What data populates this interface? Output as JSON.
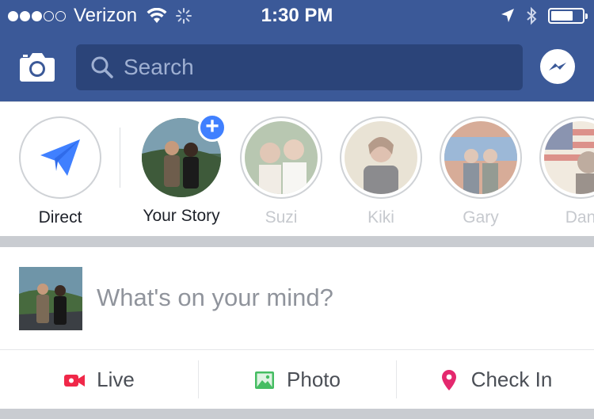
{
  "status_bar": {
    "carrier": "Verizon",
    "time": "1:30 PM",
    "signal_bars_full": 3,
    "signal_bars_total": 5,
    "battery_level": 0.7
  },
  "nav": {
    "search_placeholder": "Search",
    "icons": [
      "camera-icon",
      "search-icon",
      "messenger-icon"
    ]
  },
  "stories": {
    "direct_label": "Direct",
    "your_story_label": "Your Story",
    "friends": [
      {
        "name": "Suzi"
      },
      {
        "name": "Kiki"
      },
      {
        "name": "Gary"
      },
      {
        "name": "Dan"
      }
    ]
  },
  "composer": {
    "placeholder": "What's on your mind?"
  },
  "actions": {
    "live_label": "Live",
    "photo_label": "Photo",
    "checkin_label": "Check In"
  },
  "colors": {
    "brand_blue": "#3b5998",
    "search_bg": "#2b4479",
    "accent_blue": "#4080ff",
    "live_red": "#f02849",
    "photo_green": "#45bd62",
    "checkin_pink": "#e4286e"
  }
}
